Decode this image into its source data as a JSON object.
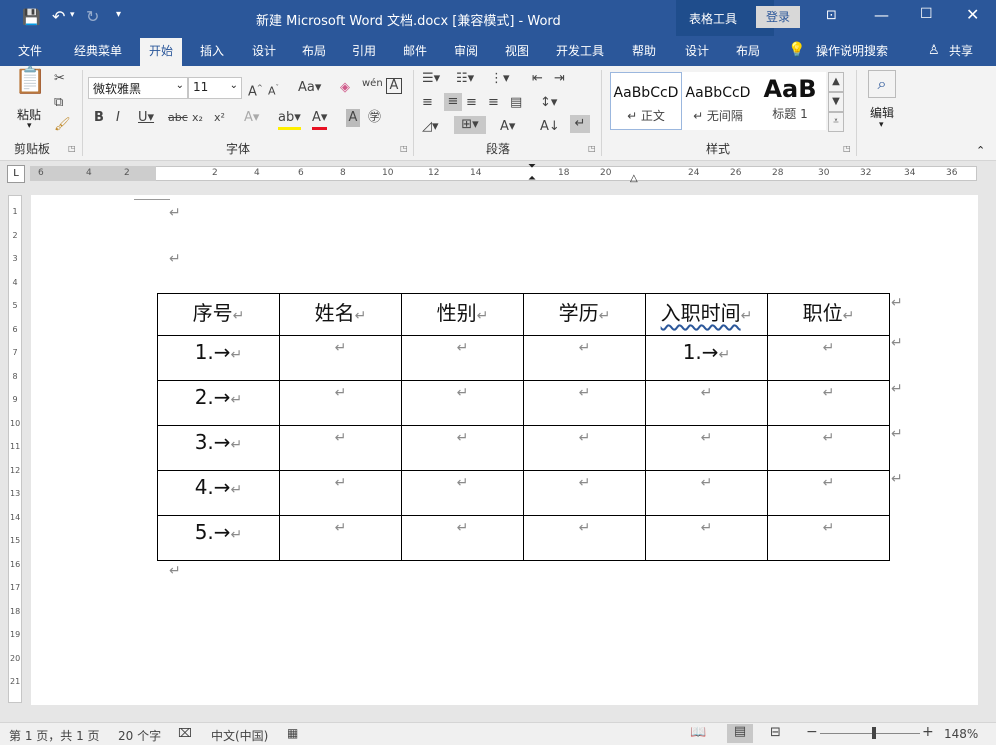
{
  "window": {
    "title": "新建 Microsoft Word 文档.docx [兼容模式] - Word",
    "context_label": "表格工具",
    "login_label": "登录"
  },
  "tabs": [
    "文件",
    "经典菜单",
    "开始",
    "插入",
    "设计",
    "布局",
    "引用",
    "邮件",
    "审阅",
    "视图",
    "开发工具",
    "帮助",
    "设计",
    "布局"
  ],
  "tell_me": "操作说明搜索",
  "share": "共享",
  "ribbon": {
    "clipboard": {
      "paste": "粘贴",
      "label": "剪贴板"
    },
    "font": {
      "name": "微软雅黑",
      "size": "11",
      "label": "字体"
    },
    "paragraph": {
      "label": "段落"
    },
    "styles": {
      "label": "样式",
      "items": [
        {
          "sample": "AaBbCcD",
          "name": "↵ 正文"
        },
        {
          "sample": "AaBbCcD",
          "name": "↵ 无间隔"
        },
        {
          "sample": "AaB",
          "name": "标题 1"
        }
      ]
    },
    "editing": {
      "label": "编辑"
    }
  },
  "ruler_h_labels": [
    "6",
    "4",
    "2",
    "2",
    "4",
    "6",
    "8",
    "10",
    "12",
    "14",
    "18",
    "20",
    "24",
    "26",
    "28",
    "30",
    "32",
    "34",
    "36"
  ],
  "ruler_v_labels": [
    "1",
    "2",
    "3",
    "4",
    "5",
    "6",
    "7",
    "8",
    "9",
    "10",
    "11",
    "12",
    "13",
    "14",
    "15",
    "16",
    "17",
    "18",
    "19",
    "20",
    "21"
  ],
  "table": {
    "headers": [
      "序号",
      "姓名",
      "性别",
      "学历",
      "入职时间",
      "职位"
    ],
    "rows": [
      [
        "1.→",
        "",
        "",
        "",
        "1.→",
        ""
      ],
      [
        "2.→",
        "",
        "",
        "",
        "",
        ""
      ],
      [
        "3.→",
        "",
        "",
        "",
        "",
        ""
      ],
      [
        "4.→",
        "",
        "",
        "",
        "",
        ""
      ],
      [
        "5.→",
        "",
        "",
        "",
        "",
        ""
      ]
    ]
  },
  "status": {
    "page": "第 1 页，共 1 页",
    "words": "20 个字",
    "lang": "中文(中国)",
    "zoom": "148%"
  },
  "colors": {
    "brand": "#2b579a",
    "context_tab": "#1f4d8c"
  }
}
